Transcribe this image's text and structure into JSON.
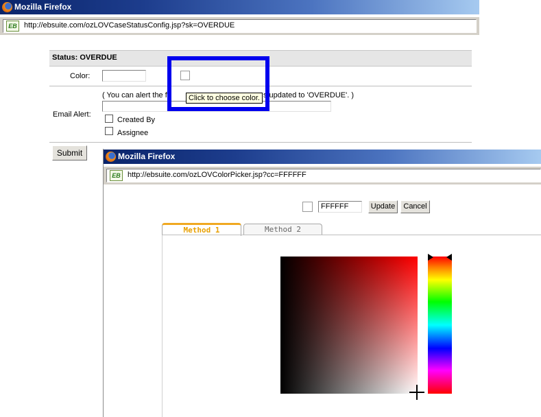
{
  "main_window": {
    "title": "Mozilla Firefox",
    "url": "http://ebsuite.com/ozLOVCaseStatusConfig.jsp?sk=OVERDUE",
    "site_badge": "EB"
  },
  "form": {
    "status_header": "Status: OVERDUE",
    "color_label": "Color:",
    "color_value": "",
    "email_label": "Email Alert:",
    "alert_note_start": "( You can alert the f",
    "alert_note_end": "s updated to 'OVERDUE'. )",
    "email_value": "",
    "created_by_label": "Created By",
    "assignee_label": "Assignee",
    "submit_label": "Submit"
  },
  "tooltip": {
    "text": "Click to choose color."
  },
  "popup": {
    "title": "Mozilla Firefox",
    "url": "http://ebsuite.com/ozLOVColorPicker.jsp?cc=FFFFFF",
    "site_badge": "EB",
    "color_value": "FFFFFF",
    "update_label": "Update",
    "cancel_label": "Cancel",
    "tabs": [
      {
        "label": "Method 1",
        "active": true
      },
      {
        "label": "Method 2",
        "active": false
      }
    ]
  },
  "colors": {
    "highlight": "#0000ee",
    "active_tab": "#e8a000"
  }
}
